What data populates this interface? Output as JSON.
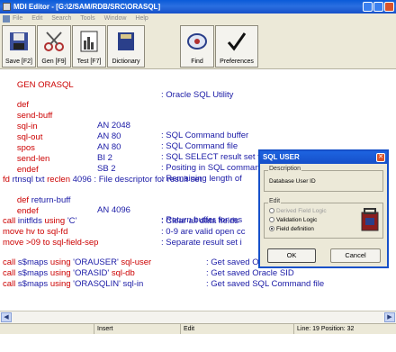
{
  "window": {
    "title": "MDI Editor - [G:\\2/SAM/RDB/SRC\\ORASQL]"
  },
  "menu": [
    "File",
    "Edit",
    "Search",
    "Tools",
    "Window",
    "Help"
  ],
  "toolbar": [
    {
      "label": "Save [F2]",
      "icon": "floppy-disk-icon"
    },
    {
      "label": "Gen [F9]",
      "icon": "scissors-icon"
    },
    {
      "label": "Test [F7]",
      "icon": "test-icon"
    },
    {
      "label": "Dictionary",
      "icon": "book-icon"
    },
    {
      "label": "Find",
      "icon": "find-icon"
    },
    {
      "label": "Preferences",
      "icon": "checkmark-icon"
    }
  ],
  "code": {
    "l1": {
      "a": "GEN ORASQL",
      "c": ": Oracle SQL Utility"
    },
    "l2": {
      "a": "def"
    },
    "l3": {
      "a": "send-buff",
      "b": "AN 2048",
      "c": ": SQL Command buffer"
    },
    "l4": {
      "a": "sql-in",
      "b": "AN 80",
      "c": ": SQL Command file"
    },
    "l5": {
      "a": "sql-out",
      "b": "AN 80",
      "c": ": SQL SELECT result set file"
    },
    "l6": {
      "a": "spos",
      "b": "BI 2",
      "c": ": Positing in SQL command"
    },
    "l7": {
      "a": "send-len",
      "b": "SB 2",
      "c": ": Remaining length of"
    },
    "l8": {
      "a": "endef"
    },
    "l9": {
      "a": "fd",
      "b": " rtnsql txt ",
      "k": "reclen",
      "d": " 4096",
      "c": " : File descriptor for result set"
    },
    "l10": {
      "a": "def",
      "b": " return-buff",
      "d": "AN 4096",
      "c": ": Return buffer for res"
    },
    "l11": {
      "a": "endef"
    },
    "l12": {
      "k1": "call",
      "a": " initflds ",
      "k2": "using",
      "b": " 'C'",
      "c": ": Clear all data fields"
    },
    "l13": {
      "k1": "move",
      "a": " hv ",
      "k2": "to",
      "b": " sql-fd",
      "c": ": 0-9 are valid open cc"
    },
    "l14": {
      "k1": "move",
      "a": " >09 ",
      "k2": "to",
      "b": " sql-field-sep",
      "c": ": Separate result set i"
    },
    "l15": {
      "k1": "call",
      "a": " s$maps ",
      "k2": "using",
      "b": " 'ORAUSER' ",
      "d": "sql-user",
      "c": ": Get saved Oracle User"
    },
    "l16": {
      "k1": "call",
      "a": " s$maps ",
      "k2": "using",
      "b": " 'ORASID' ",
      "d": "sql-db",
      "c": ": Get saved Oracle SID"
    },
    "l17": {
      "k1": "call",
      "a": " s$maps ",
      "k2": "using",
      "b": " 'ORASQLIN' ",
      "d": "sql-in",
      "c": ": Get saved SQL Command file"
    }
  },
  "dialog": {
    "title": "SQL USER",
    "description_label": "Description",
    "description_value": "Database User ID",
    "edit_label": "Edit",
    "options": [
      "Derived Field Logic",
      "Validation Logic",
      "Field definition"
    ],
    "selected_option": "Field definition",
    "ok_label": "OK",
    "cancel_label": "Cancel"
  },
  "status": {
    "mode": "Insert",
    "edit": "Edit",
    "position": "Line: 19  Position: 32"
  },
  "colors": {
    "keyword": "#cc0000",
    "code": "#1a1aa6",
    "titlebar": "#1650c9"
  }
}
